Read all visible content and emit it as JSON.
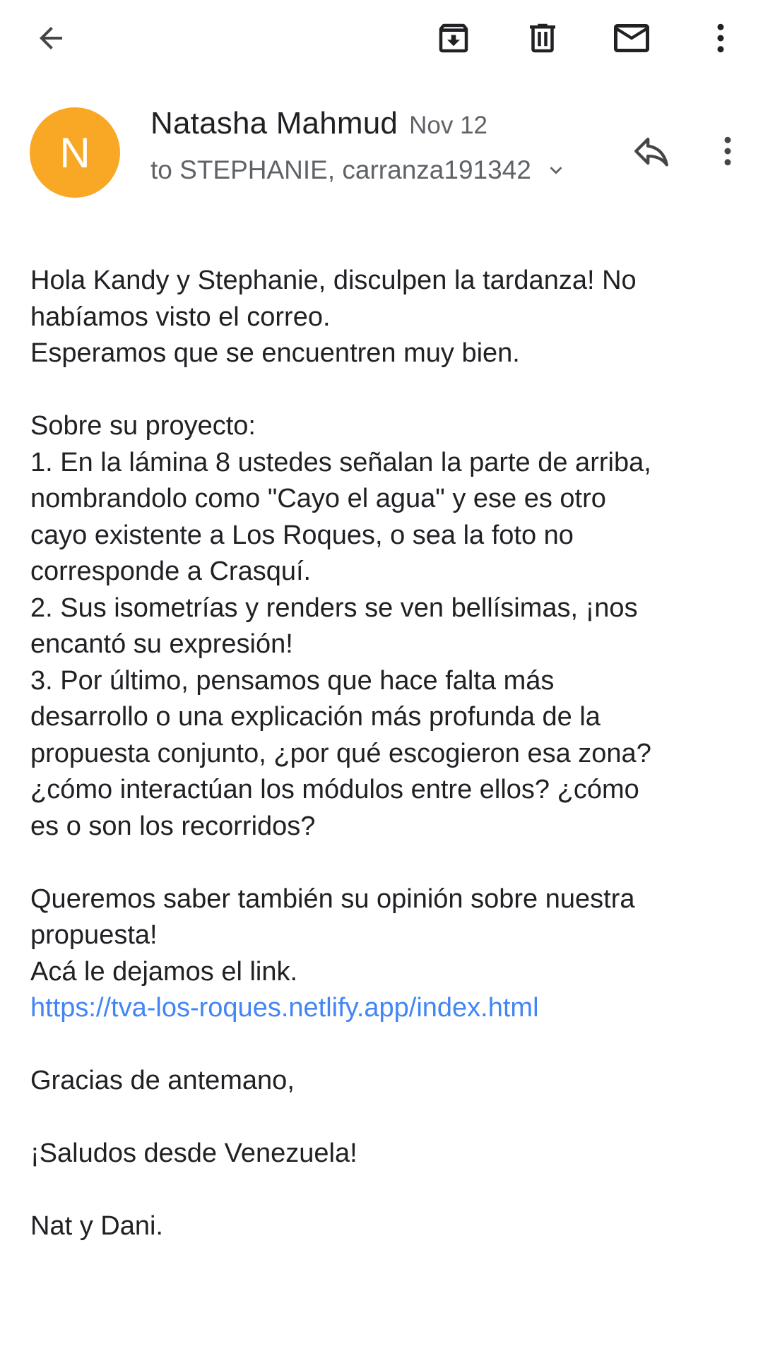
{
  "toolbar": {
    "back_icon": "arrow-back-icon",
    "archive_icon": "archive-icon",
    "delete_icon": "trash-icon",
    "unread_icon": "mail-icon",
    "overflow_icon": "more-vert-icon"
  },
  "header": {
    "avatar_letter": "N",
    "avatar_color": "#F9A825",
    "sender_name": "Natasha Mahmud",
    "date": "Nov 12",
    "recipients": "to STEPHANIE, carranza191342",
    "reply_icon": "reply-icon",
    "more_icon": "more-vert-icon"
  },
  "body": {
    "greeting_1": "Hola Kandy y Stephanie, disculpen la tardanza! No",
    "greeting_2": "habíamos visto el correo.",
    "greeting_3": "Esperamos que se encuentren muy bien.",
    "project_title": "Sobre su proyecto:",
    "p1_1": "1. En la lámina 8 ustedes señalan la parte de arriba,",
    "p1_2": "nombrandolo como \"Cayo el agua\" y ese es otro",
    "p1_3": "cayo existente a Los Roques, o sea la foto no",
    "p1_4": "corresponde a Crasquí.",
    "p2_1": "2. Sus isometrías y renders se ven bellísimas, ¡nos",
    "p2_2": "encantó su expresión!",
    "p3_1": "3. Por último, pensamos que hace falta más",
    "p3_2": "desarrollo o una explicación más profunda de la",
    "p3_3": "propuesta conjunto, ¿por qué escogieron esa zona?",
    "p3_4": "¿cómo interactúan los módulos entre ellos? ¿cómo",
    "p3_5": "es o son los recorridos?",
    "opinion_1": "Queremos saber también su opinión sobre nuestra",
    "opinion_2": "propuesta!",
    "opinion_3": "Acá le dejamos el link.",
    "link": "https://tva-los-roques.netlify.app/index.html",
    "thanks": "Gracias de antemano,",
    "regards": "¡Saludos desde Venezuela!",
    "signature": "Nat y Dani.",
    "link_color": "#4285F4"
  }
}
